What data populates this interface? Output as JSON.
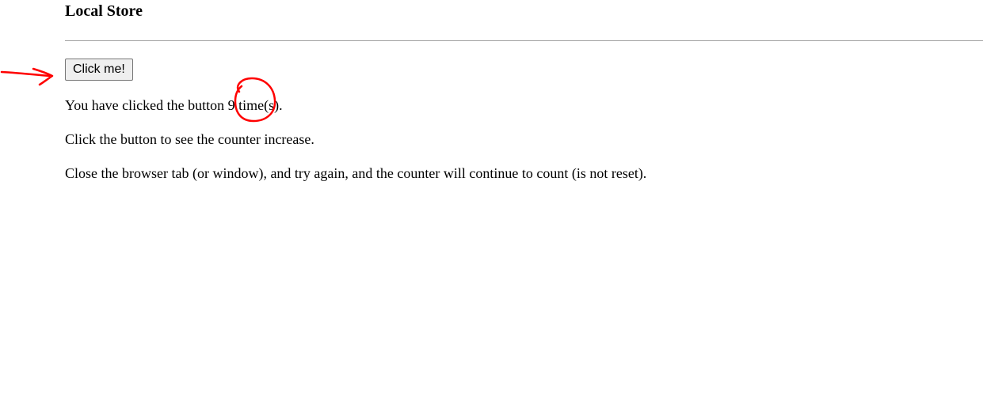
{
  "page": {
    "title": "Local Store"
  },
  "button": {
    "label": "Click me!"
  },
  "result": {
    "prefix": "You have clicked the button ",
    "count": "9",
    "suffix": " time(s)."
  },
  "paragraphs": [
    "Click the button to see the counter increase.",
    "Close the browser tab (or window), and try again, and the counter will continue to count (is not reset)."
  ],
  "annotations": {
    "color": "#ff0000",
    "items": [
      "arrow-pointing-to-button",
      "circle-around-count"
    ]
  }
}
